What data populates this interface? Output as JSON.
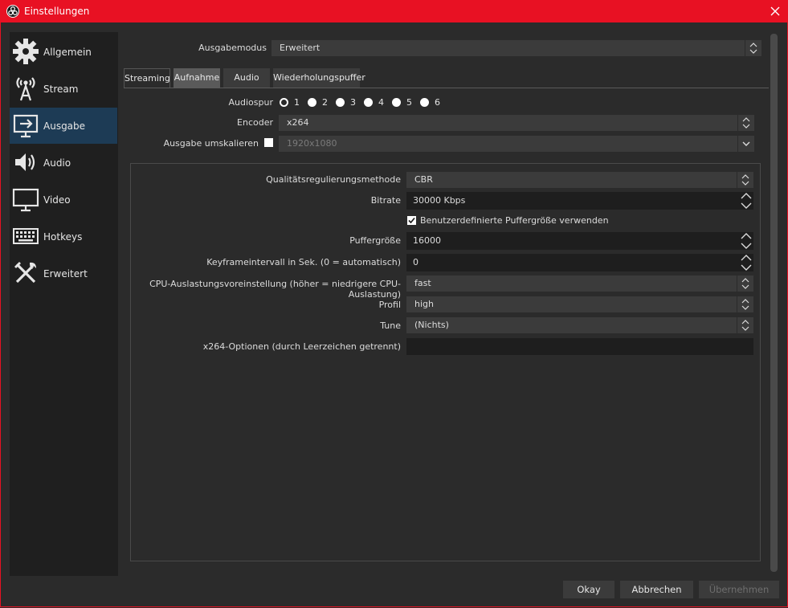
{
  "window": {
    "title": "Einstellungen"
  },
  "sidebar": {
    "items": [
      {
        "label": "Allgemein",
        "icon": "gear-icon"
      },
      {
        "label": "Stream",
        "icon": "broadcast-tower-icon"
      },
      {
        "label": "Ausgabe",
        "icon": "output-monitor-icon",
        "active": true
      },
      {
        "label": "Audio",
        "icon": "speaker-icon"
      },
      {
        "label": "Video",
        "icon": "monitor-icon"
      },
      {
        "label": "Hotkeys",
        "icon": "keyboard-icon"
      },
      {
        "label": "Erweitert",
        "icon": "tools-icon"
      }
    ]
  },
  "output_mode": {
    "label": "Ausgabemodus",
    "value": "Erweitert"
  },
  "tabs": [
    "Streaming",
    "Aufnahme",
    "Audio",
    "Wiederholungspuffer"
  ],
  "active_tab": "Aufnahme",
  "audio_track": {
    "label": "Audiospur",
    "options": [
      "1",
      "2",
      "3",
      "4",
      "5",
      "6"
    ],
    "selected": "1"
  },
  "encoder": {
    "label": "Encoder",
    "value": "x264"
  },
  "rescale": {
    "label": "Ausgabe umskalieren",
    "checked": false,
    "value": "1920x1080"
  },
  "settings": {
    "rate_control": {
      "label": "Qualitätsregulierungsmethode",
      "value": "CBR"
    },
    "bitrate": {
      "label": "Bitrate",
      "value": "30000 Kbps"
    },
    "custom_buffer": {
      "label": "Benutzerdefinierte Puffergröße verwenden",
      "checked": true
    },
    "buffer_size": {
      "label": "Puffergröße",
      "value": "16000"
    },
    "keyframe": {
      "label": "Keyframeintervall in Sek. (0 = automatisch)",
      "value": "0"
    },
    "cpu_preset": {
      "label": "CPU-Auslastungsvoreinstellung (höher = niedrigere CPU-Auslastung)",
      "value": "fast"
    },
    "profile": {
      "label": "Profil",
      "value": "high"
    },
    "tune": {
      "label": "Tune",
      "value": "(Nichts)"
    },
    "x264_options": {
      "label": "x264-Optionen (durch Leerzeichen getrennt)",
      "value": ""
    }
  },
  "buttons": {
    "ok": "Okay",
    "cancel": "Abbrechen",
    "apply": "Übernehmen"
  },
  "colors": {
    "titlebar": "#e81123",
    "background": "#2b2b2b",
    "sidebar": "#1f1f1f",
    "active_item": "#1d3b55"
  }
}
